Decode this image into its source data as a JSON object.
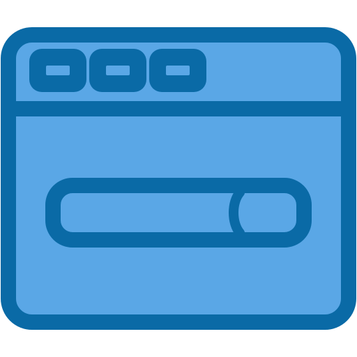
{
  "icon": {
    "name": "browser-window-search-icon",
    "colors": {
      "fill": "#5aa7e6",
      "stroke": "#0a6aa6",
      "background": "#ffffff"
    },
    "window_controls": [
      "control-1",
      "control-2",
      "control-3"
    ],
    "search_bar": {
      "icon": "search-bar-icon"
    }
  }
}
